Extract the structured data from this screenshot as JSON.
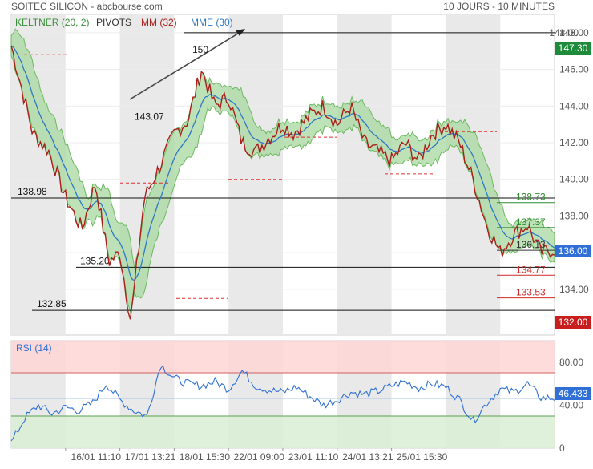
{
  "header": {
    "title": "SOITEC SILICON - abcbourse.com",
    "period": "10 JOURS - 10 MINUTES"
  },
  "legend": {
    "keltner": "KELTNER (20, 2)",
    "pivots": "PIVOTS",
    "mm": "MM (32)",
    "mme": "MME (30)"
  },
  "colors": {
    "price": "#a8201a",
    "mme": "#2f78c4",
    "keltner_fill": "#a8d8a0",
    "keltner_line": "#6cba60",
    "pivot_dash": "#e03030",
    "support_line": "#111111",
    "price_badge_bg": "#1d8b3a",
    "current_badge_bg": "#2f6fd6",
    "low_badge_bg": "#c81e1e",
    "rsi_line": "#2f6fd6",
    "rsi_overbought": "#ffd6d6",
    "rsi_oversold": "#d9eed3",
    "session_shade": "#e9e9e9"
  },
  "chart_data": [
    {
      "type": "line",
      "title": "SOITEC SILICON",
      "ylim": [
        131.5,
        149
      ],
      "y_ticks": [
        134,
        136,
        138,
        140,
        142,
        144,
        146,
        148
      ],
      "x_ticks": [
        "16/01 11:10",
        "17/01 13:21",
        "18/01 15:30",
        "22/01 09:00",
        "23/01 11:10",
        "24/01 13:21",
        "25/01 15:30"
      ],
      "grid": true,
      "badges": {
        "high": "147.30",
        "current": "136.00",
        "low": "132.00"
      },
      "horizontal_levels": [
        {
          "label": "148.00",
          "value": 148.0
        },
        {
          "label": "143.07",
          "value": 143.07
        },
        {
          "label": "138.98",
          "value": 138.98
        },
        {
          "label": "135.20",
          "value": 135.2
        },
        {
          "label": "132.85",
          "value": 132.85
        }
      ],
      "pivot_labels": [
        {
          "label": "138.73",
          "value": 138.73
        },
        {
          "label": "137.37",
          "value": 137.37
        },
        {
          "label": "136.13",
          "value": 136.13
        },
        {
          "label": "134.77",
          "value": 134.77
        },
        {
          "label": "133.53",
          "value": 133.53
        }
      ],
      "annotation": {
        "text": "150"
      },
      "series": [
        {
          "name": "",
          "x": [
            0,
            0.8,
            1.4,
            2.0,
            2.6,
            3.1,
            3.6,
            4.0,
            4.4,
            4.9,
            5.4,
            6.0,
            6.5,
            7.0,
            7.5,
            8.0,
            8.5,
            9.0,
            9.5,
            10.0
          ],
          "values": [
            147.3,
            142.5,
            141.5,
            139.0,
            137.3,
            139.8,
            135.5,
            136.0,
            132.3,
            139.0,
            140.5,
            142.5,
            143.2,
            146.0,
            144.0,
            144.5,
            142.0,
            141.5,
            142.3,
            143.0
          ]
        },
        {
          "name": "",
          "x": [
            10.0,
            10.4,
            11.0,
            11.5,
            12.0,
            12.5,
            13.0,
            13.5,
            14.0,
            14.5,
            15.0,
            15.5,
            16.0,
            16.5,
            17.0,
            17.5,
            18.0,
            18.5,
            19.0,
            19.5,
            20.0
          ],
          "values": [
            143.0,
            142.5,
            143.5,
            144.0,
            143.0,
            144.0,
            142.0,
            141.5,
            141.0,
            142.0,
            141.0,
            142.5,
            143.0,
            142.0,
            140.0,
            137.5,
            136.0,
            137.0,
            137.5,
            136.0,
            136.2
          ]
        }
      ]
    },
    {
      "type": "line",
      "title": "RSI (14)",
      "ylim": [
        0,
        100
      ],
      "y_ticks": [
        0,
        40,
        80
      ],
      "bands": {
        "overbought": 70,
        "oversold": 30
      },
      "current": "46.433",
      "series": [
        {
          "name": "",
          "x": [
            0,
            0.5,
            1.0,
            1.5,
            2.0,
            2.5,
            3.0,
            3.5,
            4.0,
            4.5,
            5.0,
            5.5,
            6.0,
            6.5,
            7.0,
            7.5,
            8.0,
            8.5,
            9.0,
            9.5,
            10.0,
            10.5,
            11.0,
            11.5,
            12.0,
            12.5,
            13.0,
            13.5,
            14.0,
            14.5,
            15.0,
            15.5,
            16.0,
            16.5,
            17.0,
            17.5,
            18.0,
            18.5,
            19.0,
            19.5,
            20.0
          ],
          "values": [
            5,
            28,
            40,
            32,
            38,
            35,
            42,
            60,
            45,
            35,
            30,
            78,
            65,
            60,
            58,
            62,
            55,
            72,
            58,
            54,
            52,
            57,
            48,
            40,
            45,
            52,
            50,
            53,
            58,
            62,
            56,
            60,
            57,
            45,
            25,
            42,
            55,
            52,
            60,
            47,
            46.4
          ]
        }
      ]
    }
  ]
}
